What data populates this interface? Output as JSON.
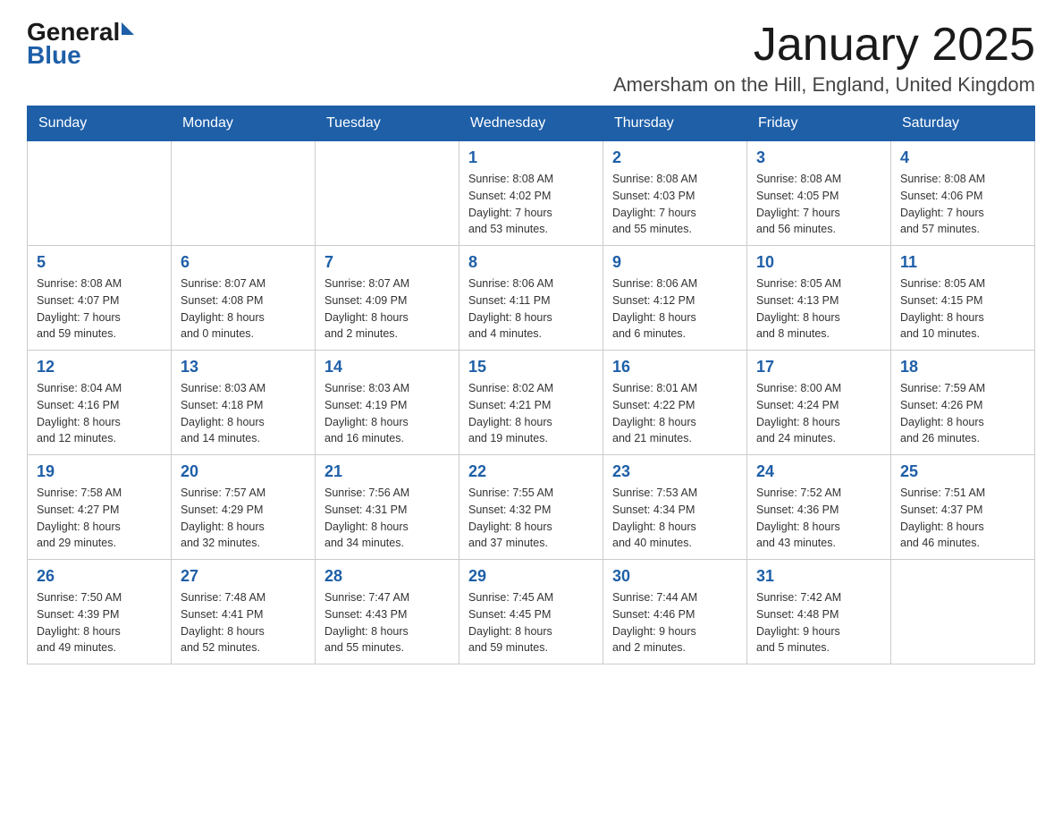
{
  "logo": {
    "general": "General",
    "blue": "Blue"
  },
  "title": "January 2025",
  "location": "Amersham on the Hill, England, United Kingdom",
  "days_of_week": [
    "Sunday",
    "Monday",
    "Tuesday",
    "Wednesday",
    "Thursday",
    "Friday",
    "Saturday"
  ],
  "weeks": [
    [
      {
        "day": "",
        "info": ""
      },
      {
        "day": "",
        "info": ""
      },
      {
        "day": "",
        "info": ""
      },
      {
        "day": "1",
        "info": "Sunrise: 8:08 AM\nSunset: 4:02 PM\nDaylight: 7 hours\nand 53 minutes."
      },
      {
        "day": "2",
        "info": "Sunrise: 8:08 AM\nSunset: 4:03 PM\nDaylight: 7 hours\nand 55 minutes."
      },
      {
        "day": "3",
        "info": "Sunrise: 8:08 AM\nSunset: 4:05 PM\nDaylight: 7 hours\nand 56 minutes."
      },
      {
        "day": "4",
        "info": "Sunrise: 8:08 AM\nSunset: 4:06 PM\nDaylight: 7 hours\nand 57 minutes."
      }
    ],
    [
      {
        "day": "5",
        "info": "Sunrise: 8:08 AM\nSunset: 4:07 PM\nDaylight: 7 hours\nand 59 minutes."
      },
      {
        "day": "6",
        "info": "Sunrise: 8:07 AM\nSunset: 4:08 PM\nDaylight: 8 hours\nand 0 minutes."
      },
      {
        "day": "7",
        "info": "Sunrise: 8:07 AM\nSunset: 4:09 PM\nDaylight: 8 hours\nand 2 minutes."
      },
      {
        "day": "8",
        "info": "Sunrise: 8:06 AM\nSunset: 4:11 PM\nDaylight: 8 hours\nand 4 minutes."
      },
      {
        "day": "9",
        "info": "Sunrise: 8:06 AM\nSunset: 4:12 PM\nDaylight: 8 hours\nand 6 minutes."
      },
      {
        "day": "10",
        "info": "Sunrise: 8:05 AM\nSunset: 4:13 PM\nDaylight: 8 hours\nand 8 minutes."
      },
      {
        "day": "11",
        "info": "Sunrise: 8:05 AM\nSunset: 4:15 PM\nDaylight: 8 hours\nand 10 minutes."
      }
    ],
    [
      {
        "day": "12",
        "info": "Sunrise: 8:04 AM\nSunset: 4:16 PM\nDaylight: 8 hours\nand 12 minutes."
      },
      {
        "day": "13",
        "info": "Sunrise: 8:03 AM\nSunset: 4:18 PM\nDaylight: 8 hours\nand 14 minutes."
      },
      {
        "day": "14",
        "info": "Sunrise: 8:03 AM\nSunset: 4:19 PM\nDaylight: 8 hours\nand 16 minutes."
      },
      {
        "day": "15",
        "info": "Sunrise: 8:02 AM\nSunset: 4:21 PM\nDaylight: 8 hours\nand 19 minutes."
      },
      {
        "day": "16",
        "info": "Sunrise: 8:01 AM\nSunset: 4:22 PM\nDaylight: 8 hours\nand 21 minutes."
      },
      {
        "day": "17",
        "info": "Sunrise: 8:00 AM\nSunset: 4:24 PM\nDaylight: 8 hours\nand 24 minutes."
      },
      {
        "day": "18",
        "info": "Sunrise: 7:59 AM\nSunset: 4:26 PM\nDaylight: 8 hours\nand 26 minutes."
      }
    ],
    [
      {
        "day": "19",
        "info": "Sunrise: 7:58 AM\nSunset: 4:27 PM\nDaylight: 8 hours\nand 29 minutes."
      },
      {
        "day": "20",
        "info": "Sunrise: 7:57 AM\nSunset: 4:29 PM\nDaylight: 8 hours\nand 32 minutes."
      },
      {
        "day": "21",
        "info": "Sunrise: 7:56 AM\nSunset: 4:31 PM\nDaylight: 8 hours\nand 34 minutes."
      },
      {
        "day": "22",
        "info": "Sunrise: 7:55 AM\nSunset: 4:32 PM\nDaylight: 8 hours\nand 37 minutes."
      },
      {
        "day": "23",
        "info": "Sunrise: 7:53 AM\nSunset: 4:34 PM\nDaylight: 8 hours\nand 40 minutes."
      },
      {
        "day": "24",
        "info": "Sunrise: 7:52 AM\nSunset: 4:36 PM\nDaylight: 8 hours\nand 43 minutes."
      },
      {
        "day": "25",
        "info": "Sunrise: 7:51 AM\nSunset: 4:37 PM\nDaylight: 8 hours\nand 46 minutes."
      }
    ],
    [
      {
        "day": "26",
        "info": "Sunrise: 7:50 AM\nSunset: 4:39 PM\nDaylight: 8 hours\nand 49 minutes."
      },
      {
        "day": "27",
        "info": "Sunrise: 7:48 AM\nSunset: 4:41 PM\nDaylight: 8 hours\nand 52 minutes."
      },
      {
        "day": "28",
        "info": "Sunrise: 7:47 AM\nSunset: 4:43 PM\nDaylight: 8 hours\nand 55 minutes."
      },
      {
        "day": "29",
        "info": "Sunrise: 7:45 AM\nSunset: 4:45 PM\nDaylight: 8 hours\nand 59 minutes."
      },
      {
        "day": "30",
        "info": "Sunrise: 7:44 AM\nSunset: 4:46 PM\nDaylight: 9 hours\nand 2 minutes."
      },
      {
        "day": "31",
        "info": "Sunrise: 7:42 AM\nSunset: 4:48 PM\nDaylight: 9 hours\nand 5 minutes."
      },
      {
        "day": "",
        "info": ""
      }
    ]
  ],
  "accent_color": "#1e5fa8"
}
